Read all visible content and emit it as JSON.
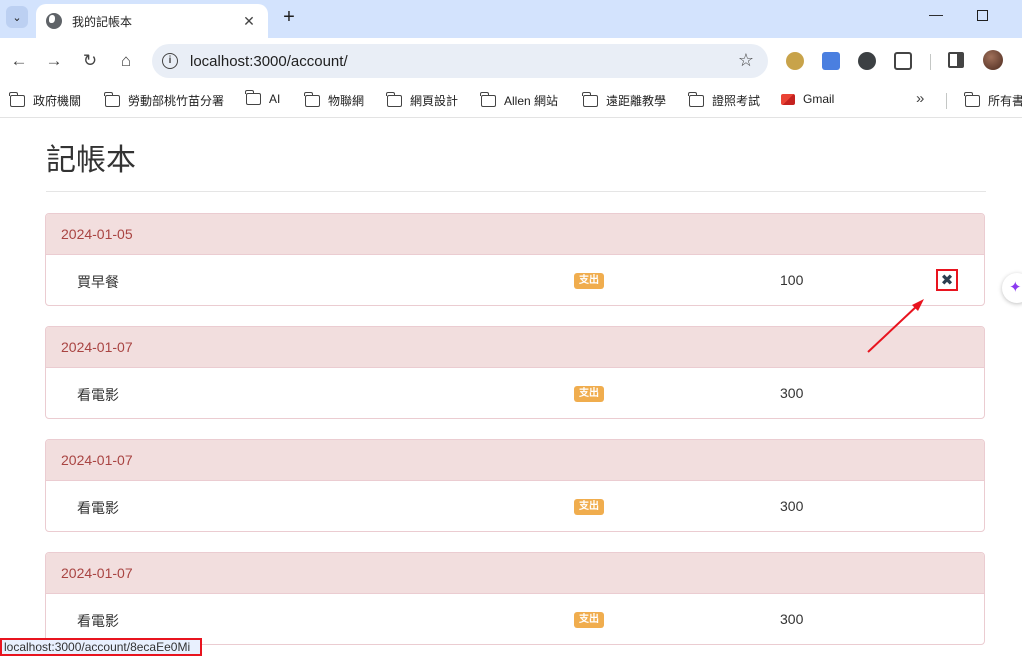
{
  "browser": {
    "tab_title": "我的記帳本",
    "tab_close": "✕",
    "new_tab": "+",
    "url": "localhost:3000/account/",
    "win_min": "—",
    "extensions": [
      "extension-1-icon",
      "translate-icon",
      "chat-extension-icon",
      "puzzle-icon"
    ]
  },
  "bookmarks": [
    {
      "label": "政府機關",
      "type": "folder"
    },
    {
      "label": "勞動部桃竹苗分署",
      "type": "folder"
    },
    {
      "label": "AI",
      "type": "folder"
    },
    {
      "label": "物聯網",
      "type": "folder"
    },
    {
      "label": "網頁設計",
      "type": "folder"
    },
    {
      "label": "Allen 網站",
      "type": "folder"
    },
    {
      "label": "遠距離教學",
      "type": "folder"
    },
    {
      "label": "證照考試",
      "type": "folder"
    },
    {
      "label": "Gmail",
      "type": "gmail"
    },
    {
      "label": "所有書",
      "type": "folder"
    }
  ],
  "page": {
    "title": "記帳本"
  },
  "entries": [
    {
      "date": "2024-01-05",
      "name": "買早餐",
      "type": "支出",
      "amount": "100"
    },
    {
      "date": "2024-01-07",
      "name": "看電影",
      "type": "支出",
      "amount": "300"
    },
    {
      "date": "2024-01-07",
      "name": "看電影",
      "type": "支出",
      "amount": "300"
    },
    {
      "date": "2024-01-07",
      "name": "看電影",
      "type": "支出",
      "amount": "300"
    }
  ],
  "status_bar": "localhost:3000/account/8ecaEe0Mi",
  "colors": {
    "panel_heading_bg": "#f2dede",
    "panel_heading_text": "#a94442",
    "badge": "#f0ad4e",
    "annotation_red": "#e8141f"
  }
}
